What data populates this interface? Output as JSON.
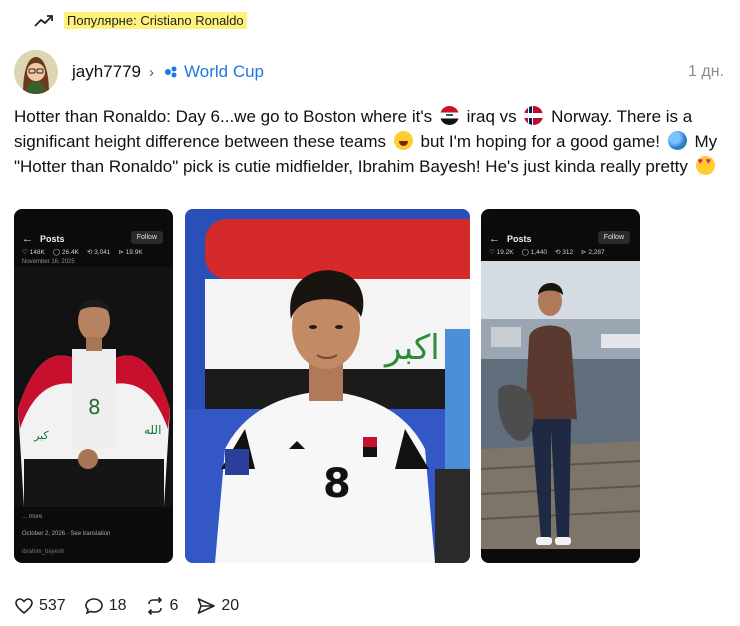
{
  "trend": {
    "label": "Популярне: Cristiano Ronaldo",
    "icon": "trending-up-icon"
  },
  "post": {
    "author": "jayh7779",
    "community": "World Cup",
    "time": "1 дн.",
    "text": {
      "p1": "Hotter than Ronaldo: Day 6...we go to Boston where it's",
      "p2": "iraq vs",
      "p3": "Norway. There is a significant height difference between these teams",
      "p4": "but I'm hoping for a good game!",
      "p5": "My \"Hotter than Ronaldo\" pick is cutie midfielder, Ibrahim Bayesh! He's just kinda really pretty"
    },
    "emojis": [
      "iraq-flag",
      "norway-flag",
      "grinning-face",
      "soccer-ball-globe",
      "heart-eyes"
    ]
  },
  "images": {
    "img1": {
      "posts_label": "Posts",
      "follow_label": "Follow",
      "stats": [
        "♡ 148K",
        "◯ 26.4K",
        "⟲ 3,041",
        "⊳ 19.9K"
      ],
      "date": "November 16, 2025",
      "caption": "... more",
      "caption_date": "October 2, 2026 · See translation",
      "caption_user": "ibrahim_bayesh"
    },
    "img2": {
      "jersey_number": "8"
    },
    "img3": {
      "posts_label": "Posts",
      "follow_label": "Follow",
      "stats": [
        "♡ 19.2K",
        "◯ 1,440",
        "⟲ 312",
        "⊳ 2,287"
      ]
    }
  },
  "actions": {
    "likes": "537",
    "comments": "18",
    "reposts": "6",
    "shares": "20"
  },
  "colors": {
    "accent": "#1d78e6",
    "trend_highlight": "#fff27a"
  }
}
